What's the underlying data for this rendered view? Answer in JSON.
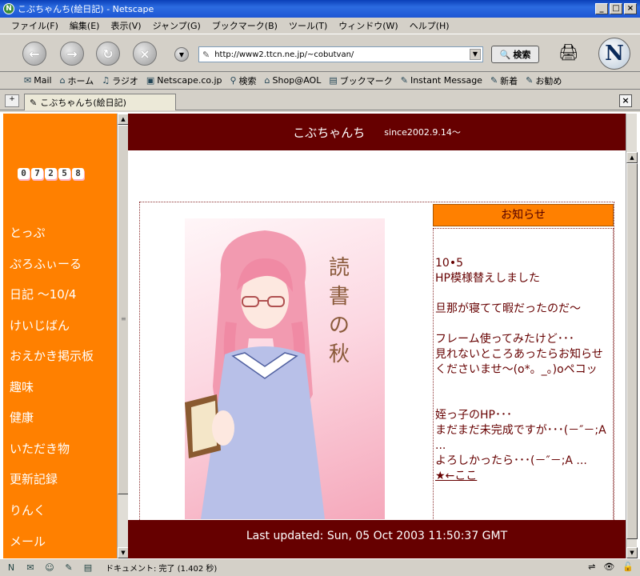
{
  "window": {
    "title": "こぶちゃんち(絵日記) - Netscape"
  },
  "menu": [
    "ファイル(F)",
    "編集(E)",
    "表示(V)",
    "ジャンプ(G)",
    "ブックマーク(B)",
    "ツール(T)",
    "ウィンドウ(W)",
    "ヘルプ(H)"
  ],
  "navbar": {
    "url": "http://www2.ttcn.ne.jp/~cobutvan/",
    "search_label": "検索"
  },
  "personal_toolbar": [
    "Mail",
    "ホーム",
    "ラジオ",
    "Netscape.co.jp",
    "検索",
    "Shop@AOL",
    "ブックマーク",
    "Instant Message",
    "新着",
    "お勧め"
  ],
  "tab": {
    "title": "こぶちゃんち(絵日記)"
  },
  "left_frame": {
    "counter": [
      "0",
      "7",
      "2",
      "5",
      "8"
    ],
    "items": [
      "とっぷ",
      "ぷろふぃーる",
      "日記 ～10/4",
      "けいじばん",
      "おえかき掲示板",
      "趣味",
      "健康",
      "いただき物",
      "更新記録",
      "りんく",
      "メール"
    ]
  },
  "header": {
    "site_name": "こぶちゃんち",
    "since": "since2002.9.14～"
  },
  "illustration": {
    "text": "読書の秋"
  },
  "news": {
    "heading": "お知らせ",
    "body": "10•5\nHP模様替えしました\n\n旦那が寝てて暇だったのだ～\n\nフレーム使ってみたけど･･･\n見れないところあったらお知らせ\nくださいませ～(o*。_。)oペコッ\n\n\n姪っ子のHP･･･\nまだまだ未完成ですが･･･(－″－;A\n...\nよろしかったら･･･(－″－;A ...",
    "link_text": "★←ここ"
  },
  "footer": {
    "last_updated": "Last updated: Sun, 05 Oct 2003 11:50:37 GMT"
  },
  "status": {
    "text": "ドキュメント: 完了 (1.402 秒)"
  },
  "colors": {
    "header_bg": "#660000",
    "sidebar_bg": "#ff8000",
    "news_text": "#660000"
  }
}
